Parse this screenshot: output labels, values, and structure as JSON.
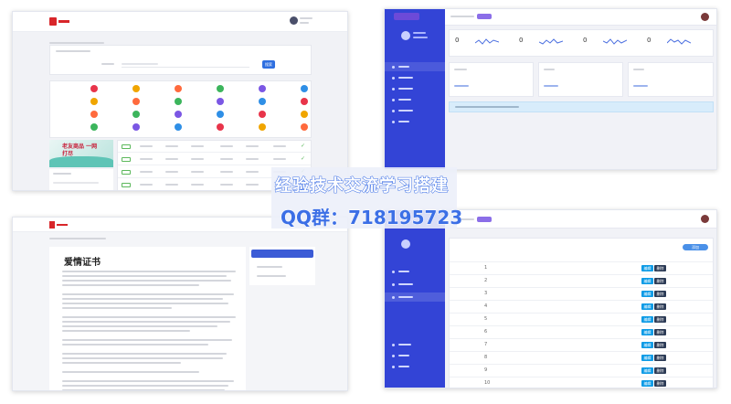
{
  "watermark": {
    "line1": "经验技术交流学习搭建",
    "line2": "QQ群：718195723"
  },
  "panel_home": {
    "search_button": "搜索",
    "categories": [
      "",
      "",
      "",
      "",
      "",
      "",
      "",
      "",
      "",
      "",
      "",
      "",
      "",
      "",
      "",
      "",
      "",
      "",
      "",
      "",
      "",
      "",
      "",
      ""
    ],
    "banner_text": "老友商品 一网打尽",
    "table_tag": "小说"
  },
  "panel_admin_dash": {
    "stats": [
      {
        "value": "0"
      },
      {
        "value": "0"
      },
      {
        "value": "0"
      },
      {
        "value": "0"
      }
    ]
  },
  "panel_article": {
    "title": "爱情证书",
    "side_button": "推荐文章"
  },
  "panel_admin_table": {
    "add_button": "添加",
    "row_ids": [
      "1",
      "2",
      "3",
      "4",
      "5",
      "6",
      "7",
      "8",
      "9",
      "10"
    ],
    "edit_label": "编辑",
    "delete_label": "删除"
  },
  "colors": {
    "sidebar": "#3344d6",
    "accent_blue": "#2f6fe0",
    "logo_red": "#d8262a",
    "watermark_stroke": "#3c6fe6"
  }
}
